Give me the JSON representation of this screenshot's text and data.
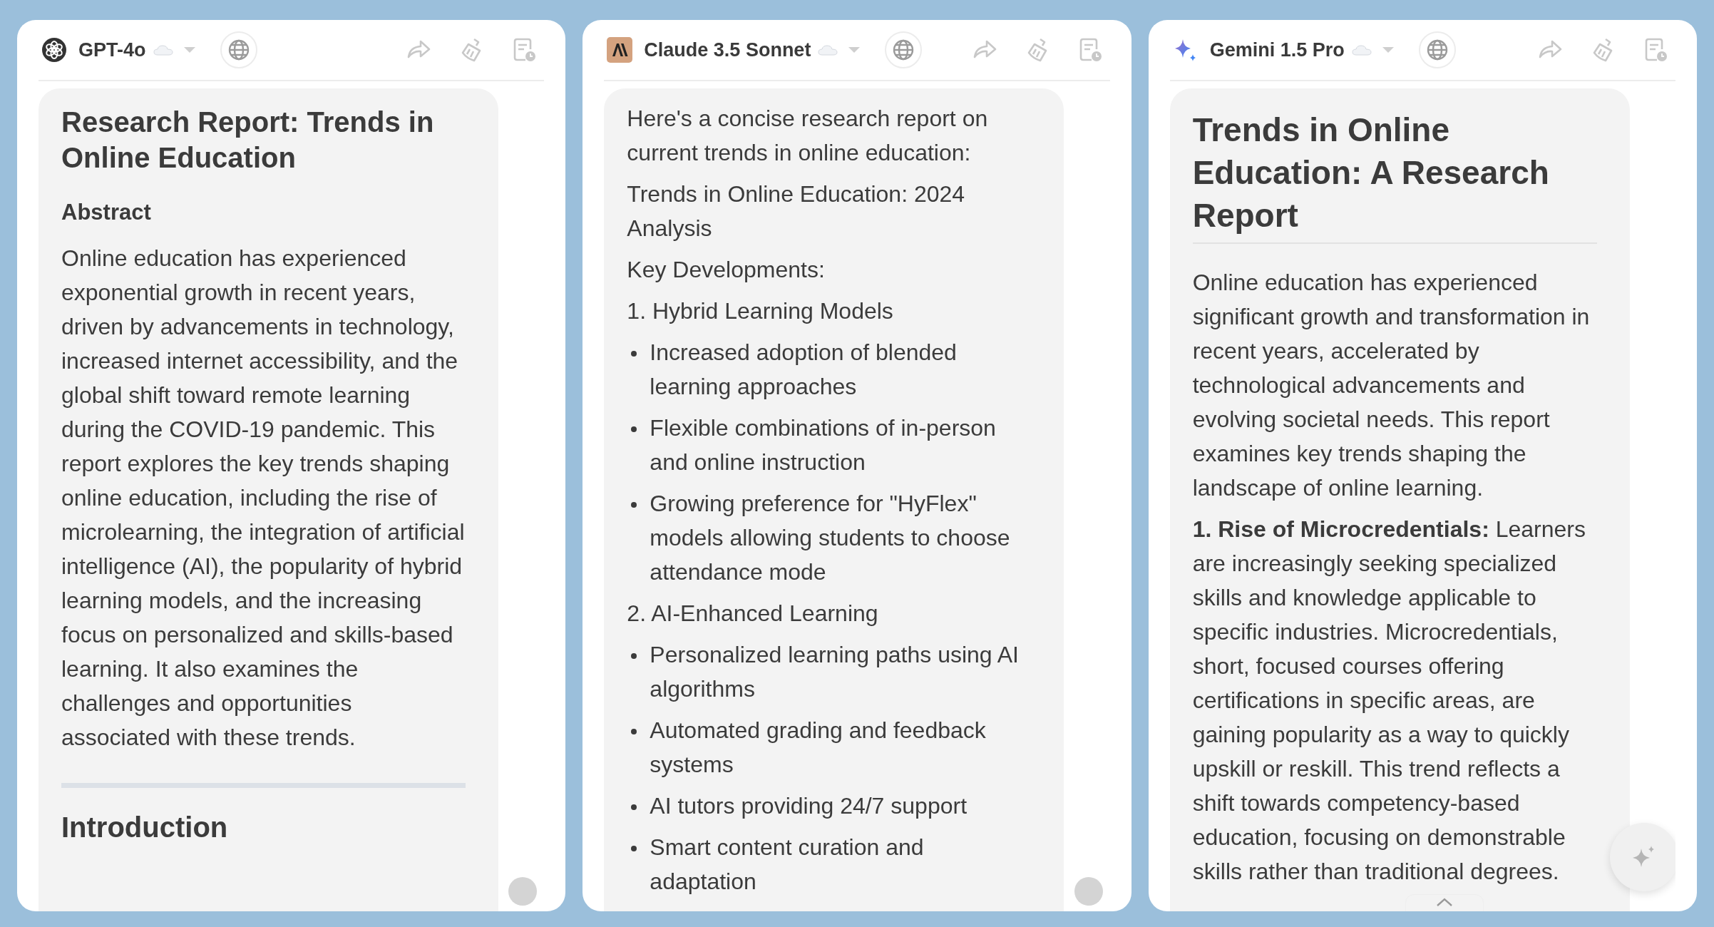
{
  "panels": [
    {
      "model": "GPT-4o",
      "kind": "openai",
      "blocks": [
        {
          "kind": "heading",
          "text": "Research Report: Trends in Online Education"
        },
        {
          "kind": "subheading",
          "text": "Abstract"
        },
        {
          "kind": "paragraph",
          "text": "Online education has experienced exponential growth in recent years, driven by advancements in technology, increased internet accessibility, and the global shift toward remote learning during the COVID-19 pandemic. This report explores the key trends shaping online education, including the rise of microlearning, the integration of artificial intelligence (AI), the popularity of hybrid learning models, and the increasing focus on personalized and skills-based learning. It also examines the challenges and opportunities associated with these trends."
        },
        {
          "kind": "divider"
        },
        {
          "kind": "section",
          "text": "Introduction"
        }
      ],
      "scroll_dot": true,
      "fab": false
    },
    {
      "model": "Claude 3.5 Sonnet",
      "kind": "anthropic",
      "blocks": [
        {
          "kind": "paragraph",
          "text": "Here's a concise research report on current trends in online education:"
        },
        {
          "kind": "paragraph",
          "text": "Trends in Online Education: 2024 Analysis"
        },
        {
          "kind": "paragraph",
          "text": "Key Developments:"
        },
        {
          "kind": "paragraph",
          "text": "1. Hybrid Learning Models"
        },
        {
          "kind": "bullet",
          "text": "Increased adoption of blended learning approaches"
        },
        {
          "kind": "bullet",
          "text": "Flexible combinations of in-person and online instruction"
        },
        {
          "kind": "bullet",
          "text": "Growing preference for \"HyFlex\" models allowing students to choose attendance mode"
        },
        {
          "kind": "paragraph",
          "text": "2. AI-Enhanced Learning"
        },
        {
          "kind": "bullet",
          "text": "Personalized learning paths using AI algorithms"
        },
        {
          "kind": "bullet",
          "text": "Automated grading and feedback systems"
        },
        {
          "kind": "bullet",
          "text": "AI tutors providing 24/7 support"
        },
        {
          "kind": "bullet",
          "text": "Smart content curation and adaptation"
        }
      ],
      "scroll_dot": true,
      "fab": false
    },
    {
      "model": "Gemini 1.5 Pro",
      "kind": "gemini",
      "blocks": [
        {
          "kind": "title",
          "text": "Trends in Online Education: A Research Report"
        },
        {
          "kind": "paragraph",
          "text": "Online education has experienced significant growth and transformation in recent years, accelerated by technological advancements and evolving societal needs. This report examines key trends shaping the landscape of online learning."
        },
        {
          "kind": "paragraph",
          "text": "**1. Rise of Microcredentials:** Learners are increasingly seeking specialized skills and knowledge applicable to specific industries. Microcredentials, short, focused courses offering certifications in specific areas, are gaining popularity as a way to quickly upskill or reskill. This trend reflects a shift towards competency-based education, focusing on demonstrable skills rather than traditional degrees."
        }
      ],
      "scroll_dot": false,
      "fab": true
    }
  ]
}
